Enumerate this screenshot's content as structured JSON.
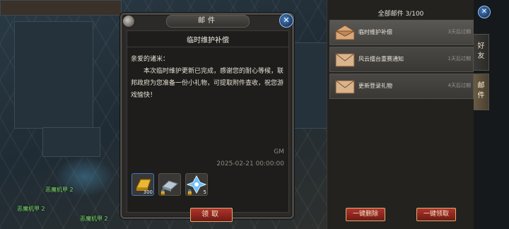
{
  "mail_detail": {
    "window_title": "邮件",
    "subject": "临时维护补偿",
    "greeting": "亲爱的诸米：",
    "body": "本次临时维护更新已完成，感谢您的耐心等候，联邦政府为您准备一份小礼物，可提取附件查收，祝您游戏愉快！",
    "sender": "GM",
    "date": "2025-02-21 00:00:00",
    "attachments": [
      {
        "icon": "gold-bar-icon",
        "count": "300",
        "locked": false
      },
      {
        "icon": "silver-plate-icon",
        "count": "",
        "locked": true
      },
      {
        "icon": "blue-crystal-icon",
        "count": "5",
        "locked": true
      }
    ],
    "claim_label": "领取",
    "close_icon": "close-icon"
  },
  "mail_list": {
    "header": "全部邮件 3/100",
    "items": [
      {
        "title": "临时维护补偿",
        "expiry": "3天后过期",
        "selected": true
      },
      {
        "title": "风云擂台重赛通知",
        "expiry": "1天后过期",
        "selected": false
      },
      {
        "title": "更新登录礼物",
        "expiry": "4天后过期",
        "selected": false
      }
    ],
    "delete_all_label": "一键删除",
    "claim_all_label": "一键领取"
  },
  "side_tabs": [
    {
      "label": "好友",
      "active": false
    },
    {
      "label": "邮件",
      "active": true
    }
  ],
  "scene_labels": [
    "恶魔机甲 2",
    "恶魔机甲 2",
    "恶魔机甲 2"
  ],
  "colors": {
    "accent_red": "#b0342c",
    "button_border": "#d8b070",
    "unit_label": "#7fe06a"
  }
}
